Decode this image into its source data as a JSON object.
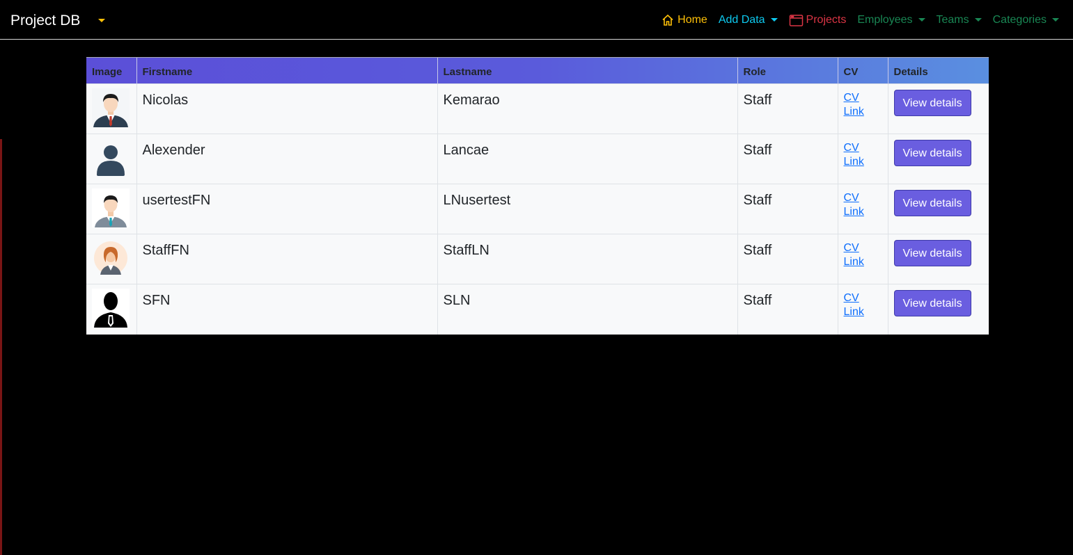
{
  "navbar": {
    "brand": "Project DB",
    "items": [
      {
        "label": "Home",
        "icon": "home-icon",
        "color": "#ffc107"
      },
      {
        "label": "Add Data",
        "icon": "",
        "color": "#0dcaf0",
        "dropdown": true
      },
      {
        "label": "Projects",
        "icon": "window-icon",
        "color": "#dc3545"
      },
      {
        "label": "Employees",
        "icon": "",
        "color": "#198754",
        "dropdown": true
      },
      {
        "label": "Teams",
        "icon": "",
        "color": "#198754",
        "dropdown": true
      },
      {
        "label": "Categories",
        "icon": "",
        "color": "#198754",
        "dropdown": true
      }
    ]
  },
  "table": {
    "headers": [
      "Image",
      "Firstname",
      "Lastname",
      "Role",
      "CV",
      "Details"
    ],
    "rows": [
      {
        "avatar": "man-red-tie-avatar",
        "firstname": "Nicolas",
        "lastname": "Kemarao",
        "role": "Staff",
        "cv": "CV Link",
        "details": "View details"
      },
      {
        "avatar": "generic-person-avatar",
        "firstname": "Alexender",
        "lastname": "Lancae",
        "role": "Staff",
        "cv": "CV Link",
        "details": "View details"
      },
      {
        "avatar": "man-blue-tie-avatar",
        "firstname": "usertestFN",
        "lastname": "LNusertest",
        "role": "Staff",
        "cv": "CV Link",
        "details": "View details"
      },
      {
        "avatar": "woman-avatar",
        "firstname": "StaffFN",
        "lastname": "StaffLN",
        "role": "Staff",
        "cv": "CV Link",
        "details": "View details"
      },
      {
        "avatar": "silhouette-tie-avatar",
        "firstname": "SFN",
        "lastname": "SLN",
        "role": "Staff",
        "cv": "CV Link",
        "details": "View details"
      }
    ]
  }
}
